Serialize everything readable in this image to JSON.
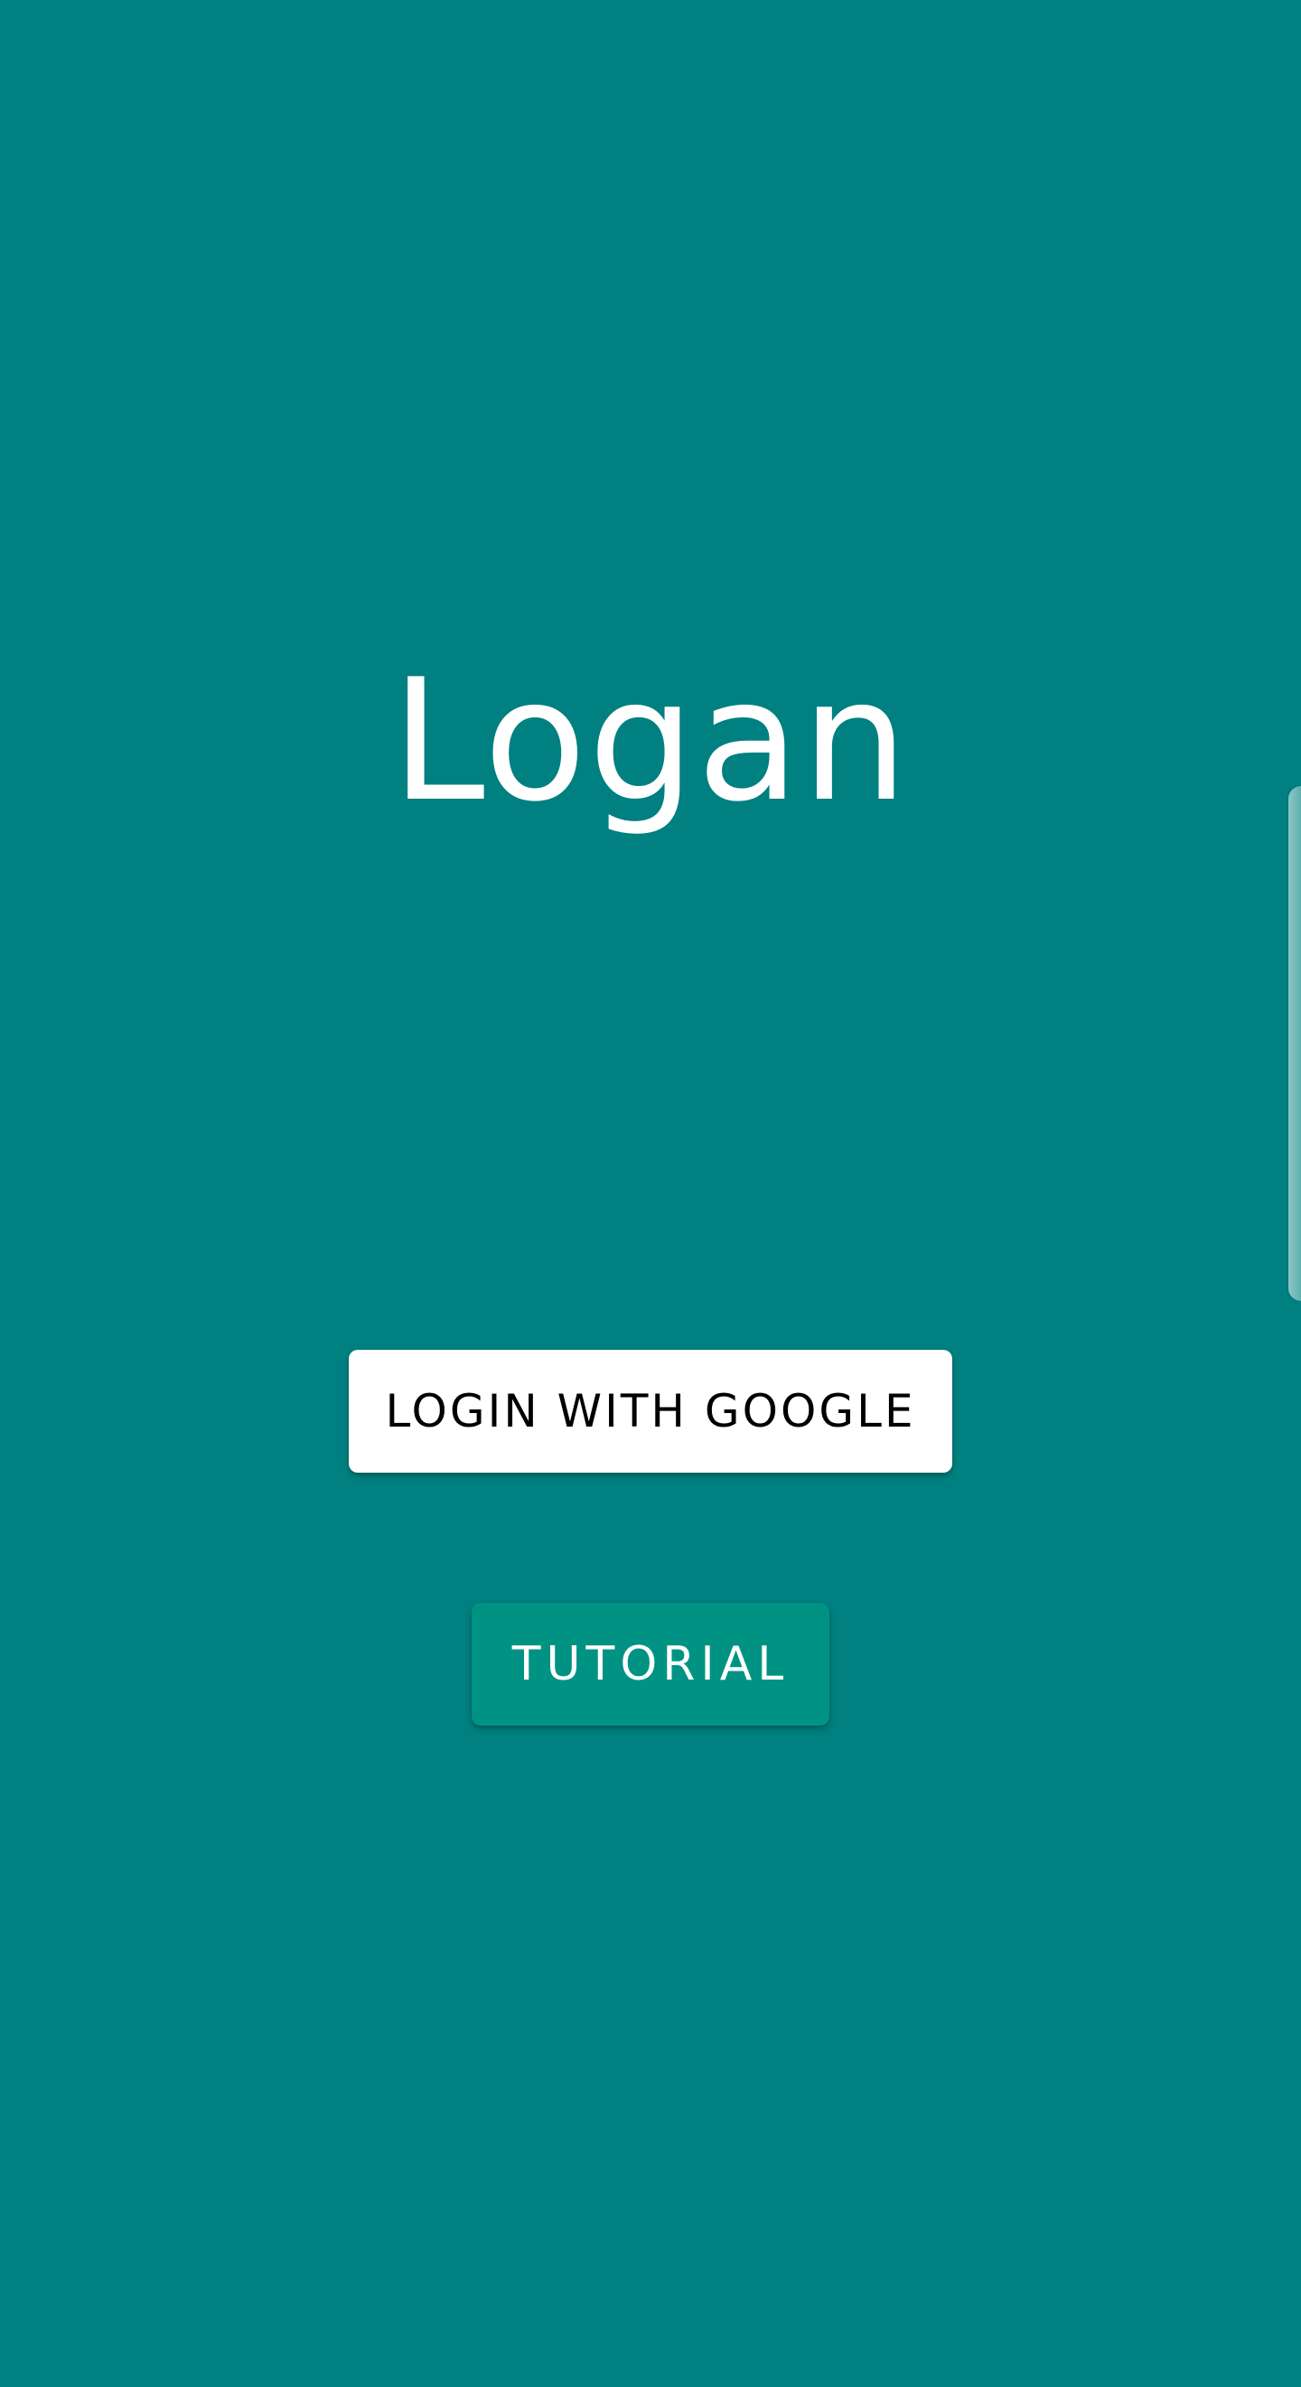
{
  "app": {
    "title": "Logan"
  },
  "actions": {
    "login_label": "LOGIN WITH GOOGLE",
    "tutorial_label": "TUTORIAL"
  },
  "colors": {
    "background": "#008080",
    "login_button_bg": "#ffffff",
    "login_button_text": "#000000",
    "tutorial_button_bg": "#009384",
    "tutorial_button_text": "#ffffff"
  }
}
